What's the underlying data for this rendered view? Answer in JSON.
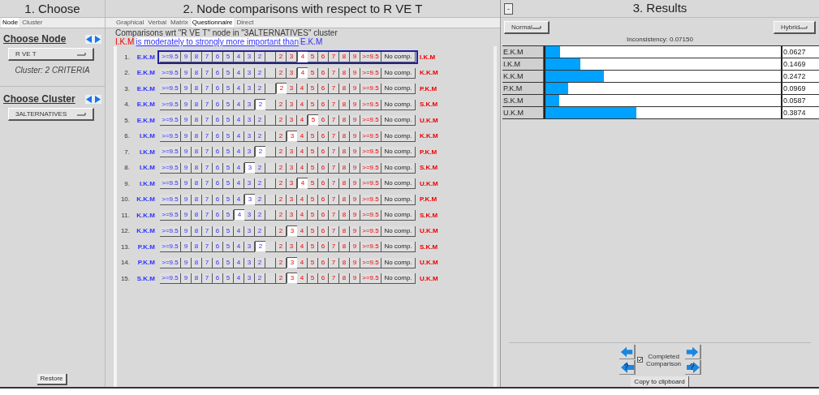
{
  "choose": {
    "title": "1. Choose",
    "tabs": [
      {
        "label": "Node",
        "selected": true
      },
      {
        "label": "Cluster",
        "selected": false
      }
    ],
    "node_heading": "Choose Node",
    "node_dropdown": "R VE T",
    "cluster_info": "Cluster: 2 CRITERIA",
    "cluster_heading": "Choose Cluster",
    "cluster_dropdown": "3ALTERNATIVES",
    "restore_button": "Restore"
  },
  "comparisons": {
    "title": "2. Node comparisons with respect to R VE T",
    "tabs": [
      {
        "label": "Graphical",
        "selected": false
      },
      {
        "label": "Verbal",
        "selected": false
      },
      {
        "label": "Matrix",
        "selected": false
      },
      {
        "label": "Questionnaire",
        "selected": true
      },
      {
        "label": "Direct",
        "selected": false
      }
    ],
    "heading": "Comparisons wrt \"R VE T\" node in \"3ALTERNATIVES\" cluster",
    "statement": {
      "subject": "I.K.M",
      "phrase": "is moderately to strongly more important than",
      "object": "E.K.M"
    },
    "rows": [
      {
        "number": "1.",
        "left": "E.K.M",
        "focused": true,
        "cells": [
          {
            "label": ">=9.5",
            "selected": false
          },
          {
            "label": "9",
            "selected": false
          },
          {
            "label": "8",
            "selected": false
          },
          {
            "label": "7",
            "selected": false
          },
          {
            "label": "6",
            "selected": false
          },
          {
            "label": "5",
            "selected": false
          },
          {
            "label": "4",
            "selected": false
          },
          {
            "label": "3",
            "selected": false
          },
          {
            "label": "2",
            "selected": false
          },
          {
            "selected": false
          },
          {
            "label": "2",
            "selected": false
          },
          {
            "label": "3",
            "selected": false
          },
          {
            "label": "4",
            "selected": true
          },
          {
            "label": "5",
            "selected": false
          },
          {
            "label": "6",
            "selected": false
          },
          {
            "label": "7",
            "selected": false
          },
          {
            "label": "8",
            "selected": false
          },
          {
            "label": "9",
            "selected": false
          },
          {
            "label": ">=9.5",
            "selected": false
          }
        ],
        "no_comp": "No comp.",
        "right": "I.K.M"
      },
      {
        "number": "2.",
        "left": "E.K.M",
        "focused": false,
        "cells": [
          {
            "label": ">=9.5",
            "selected": false
          },
          {
            "label": "9",
            "selected": false
          },
          {
            "label": "8",
            "selected": false
          },
          {
            "label": "7",
            "selected": false
          },
          {
            "label": "6",
            "selected": false
          },
          {
            "label": "5",
            "selected": false
          },
          {
            "label": "4",
            "selected": false
          },
          {
            "label": "3",
            "selected": false
          },
          {
            "label": "2",
            "selected": false
          },
          {
            "selected": false
          },
          {
            "label": "2",
            "selected": false
          },
          {
            "label": "3",
            "selected": false
          },
          {
            "label": "4",
            "selected": true
          },
          {
            "label": "5",
            "selected": false
          },
          {
            "label": "6",
            "selected": false
          },
          {
            "label": "7",
            "selected": false
          },
          {
            "label": "8",
            "selected": false
          },
          {
            "label": "9",
            "selected": false
          },
          {
            "label": ">=9.5",
            "selected": false
          }
        ],
        "no_comp": "No comp.",
        "right": "K.K.M"
      },
      {
        "number": "3.",
        "left": "E.K.M",
        "focused": false,
        "cells": [
          {
            "label": ">=9.5",
            "selected": false
          },
          {
            "label": "9",
            "selected": false
          },
          {
            "label": "8",
            "selected": false
          },
          {
            "label": "7",
            "selected": false
          },
          {
            "label": "6",
            "selected": false
          },
          {
            "label": "5",
            "selected": false
          },
          {
            "label": "4",
            "selected": false
          },
          {
            "label": "3",
            "selected": false
          },
          {
            "label": "2",
            "selected": false
          },
          {
            "selected": false
          },
          {
            "label": "2",
            "selected": true
          },
          {
            "label": "3",
            "selected": false
          },
          {
            "label": "4",
            "selected": false
          },
          {
            "label": "5",
            "selected": false
          },
          {
            "label": "6",
            "selected": false
          },
          {
            "label": "7",
            "selected": false
          },
          {
            "label": "8",
            "selected": false
          },
          {
            "label": "9",
            "selected": false
          },
          {
            "label": ">=9.5",
            "selected": false
          }
        ],
        "no_comp": "No comp.",
        "right": "P.K.M"
      },
      {
        "number": "4.",
        "left": "E.K.M",
        "focused": false,
        "cells": [
          {
            "label": ">=9.5",
            "selected": false
          },
          {
            "label": "9",
            "selected": false
          },
          {
            "label": "8",
            "selected": false
          },
          {
            "label": "7",
            "selected": false
          },
          {
            "label": "6",
            "selected": false
          },
          {
            "label": "5",
            "selected": false
          },
          {
            "label": "4",
            "selected": false
          },
          {
            "label": "3",
            "selected": false
          },
          {
            "label": "2",
            "selected": true
          },
          {
            "selected": false
          },
          {
            "label": "2",
            "selected": false
          },
          {
            "label": "3",
            "selected": false
          },
          {
            "label": "4",
            "selected": false
          },
          {
            "label": "5",
            "selected": false
          },
          {
            "label": "6",
            "selected": false
          },
          {
            "label": "7",
            "selected": false
          },
          {
            "label": "8",
            "selected": false
          },
          {
            "label": "9",
            "selected": false
          },
          {
            "label": ">=9.5",
            "selected": false
          }
        ],
        "no_comp": "No comp.",
        "right": "S.K.M"
      },
      {
        "number": "5.",
        "left": "E.K.M",
        "focused": false,
        "cells": [
          {
            "label": ">=9.5",
            "selected": false
          },
          {
            "label": "9",
            "selected": false
          },
          {
            "label": "8",
            "selected": false
          },
          {
            "label": "7",
            "selected": false
          },
          {
            "label": "6",
            "selected": false
          },
          {
            "label": "5",
            "selected": false
          },
          {
            "label": "4",
            "selected": false
          },
          {
            "label": "3",
            "selected": false
          },
          {
            "label": "2",
            "selected": false
          },
          {
            "selected": false
          },
          {
            "label": "2",
            "selected": false
          },
          {
            "label": "3",
            "selected": false
          },
          {
            "label": "4",
            "selected": false
          },
          {
            "label": "5",
            "selected": true
          },
          {
            "label": "6",
            "selected": false
          },
          {
            "label": "7",
            "selected": false
          },
          {
            "label": "8",
            "selected": false
          },
          {
            "label": "9",
            "selected": false
          },
          {
            "label": ">=9.5",
            "selected": false
          }
        ],
        "no_comp": "No comp.",
        "right": "U.K.M"
      },
      {
        "number": "6.",
        "left": "I.K.M",
        "focused": false,
        "cells": [
          {
            "label": ">=9.5",
            "selected": false
          },
          {
            "label": "9",
            "selected": false
          },
          {
            "label": "8",
            "selected": false
          },
          {
            "label": "7",
            "selected": false
          },
          {
            "label": "6",
            "selected": false
          },
          {
            "label": "5",
            "selected": false
          },
          {
            "label": "4",
            "selected": false
          },
          {
            "label": "3",
            "selected": false
          },
          {
            "label": "2",
            "selected": false
          },
          {
            "selected": false
          },
          {
            "label": "2",
            "selected": false
          },
          {
            "label": "3",
            "selected": true
          },
          {
            "label": "4",
            "selected": false
          },
          {
            "label": "5",
            "selected": false
          },
          {
            "label": "6",
            "selected": false
          },
          {
            "label": "7",
            "selected": false
          },
          {
            "label": "8",
            "selected": false
          },
          {
            "label": "9",
            "selected": false
          },
          {
            "label": ">=9.5",
            "selected": false
          }
        ],
        "no_comp": "No comp.",
        "right": "K.K.M"
      },
      {
        "number": "7.",
        "left": "I.K.M",
        "focused": false,
        "cells": [
          {
            "label": ">=9.5",
            "selected": false
          },
          {
            "label": "9",
            "selected": false
          },
          {
            "label": "8",
            "selected": false
          },
          {
            "label": "7",
            "selected": false
          },
          {
            "label": "6",
            "selected": false
          },
          {
            "label": "5",
            "selected": false
          },
          {
            "label": "4",
            "selected": false
          },
          {
            "label": "3",
            "selected": false
          },
          {
            "label": "2",
            "selected": true
          },
          {
            "selected": false
          },
          {
            "label": "2",
            "selected": false
          },
          {
            "label": "3",
            "selected": false
          },
          {
            "label": "4",
            "selected": false
          },
          {
            "label": "5",
            "selected": false
          },
          {
            "label": "6",
            "selected": false
          },
          {
            "label": "7",
            "selected": false
          },
          {
            "label": "8",
            "selected": false
          },
          {
            "label": "9",
            "selected": false
          },
          {
            "label": ">=9.5",
            "selected": false
          }
        ],
        "no_comp": "No comp.",
        "right": "P.K.M"
      },
      {
        "number": "8.",
        "left": "I.K.M",
        "focused": false,
        "cells": [
          {
            "label": ">=9.5",
            "selected": false
          },
          {
            "label": "9",
            "selected": false
          },
          {
            "label": "8",
            "selected": false
          },
          {
            "label": "7",
            "selected": false
          },
          {
            "label": "6",
            "selected": false
          },
          {
            "label": "5",
            "selected": false
          },
          {
            "label": "4",
            "selected": false
          },
          {
            "label": "3",
            "selected": true
          },
          {
            "label": "2",
            "selected": false
          },
          {
            "selected": false
          },
          {
            "label": "2",
            "selected": false
          },
          {
            "label": "3",
            "selected": false
          },
          {
            "label": "4",
            "selected": false
          },
          {
            "label": "5",
            "selected": false
          },
          {
            "label": "6",
            "selected": false
          },
          {
            "label": "7",
            "selected": false
          },
          {
            "label": "8",
            "selected": false
          },
          {
            "label": "9",
            "selected": false
          },
          {
            "label": ">=9.5",
            "selected": false
          }
        ],
        "no_comp": "No comp.",
        "right": "S.K.M"
      },
      {
        "number": "9.",
        "left": "I.K.M",
        "focused": false,
        "cells": [
          {
            "label": ">=9.5",
            "selected": false
          },
          {
            "label": "9",
            "selected": false
          },
          {
            "label": "8",
            "selected": false
          },
          {
            "label": "7",
            "selected": false
          },
          {
            "label": "6",
            "selected": false
          },
          {
            "label": "5",
            "selected": false
          },
          {
            "label": "4",
            "selected": false
          },
          {
            "label": "3",
            "selected": false
          },
          {
            "label": "2",
            "selected": false
          },
          {
            "selected": false
          },
          {
            "label": "2",
            "selected": false
          },
          {
            "label": "3",
            "selected": false
          },
          {
            "label": "4",
            "selected": true
          },
          {
            "label": "5",
            "selected": false
          },
          {
            "label": "6",
            "selected": false
          },
          {
            "label": "7",
            "selected": false
          },
          {
            "label": "8",
            "selected": false
          },
          {
            "label": "9",
            "selected": false
          },
          {
            "label": ">=9.5",
            "selected": false
          }
        ],
        "no_comp": "No comp.",
        "right": "U.K.M"
      },
      {
        "number": "10.",
        "left": "K.K.M",
        "focused": false,
        "cells": [
          {
            "label": ">=9.5",
            "selected": false
          },
          {
            "label": "9",
            "selected": false
          },
          {
            "label": "8",
            "selected": false
          },
          {
            "label": "7",
            "selected": false
          },
          {
            "label": "6",
            "selected": false
          },
          {
            "label": "5",
            "selected": false
          },
          {
            "label": "4",
            "selected": false
          },
          {
            "label": "3",
            "selected": true
          },
          {
            "label": "2",
            "selected": false
          },
          {
            "selected": false
          },
          {
            "label": "2",
            "selected": false
          },
          {
            "label": "3",
            "selected": false
          },
          {
            "label": "4",
            "selected": false
          },
          {
            "label": "5",
            "selected": false
          },
          {
            "label": "6",
            "selected": false
          },
          {
            "label": "7",
            "selected": false
          },
          {
            "label": "8",
            "selected": false
          },
          {
            "label": "9",
            "selected": false
          },
          {
            "label": ">=9.5",
            "selected": false
          }
        ],
        "no_comp": "No comp.",
        "right": "P.K.M"
      },
      {
        "number": "11.",
        "left": "K.K.M",
        "focused": false,
        "cells": [
          {
            "label": ">=9.5",
            "selected": false
          },
          {
            "label": "9",
            "selected": false
          },
          {
            "label": "8",
            "selected": false
          },
          {
            "label": "7",
            "selected": false
          },
          {
            "label": "6",
            "selected": false
          },
          {
            "label": "5",
            "selected": false
          },
          {
            "label": "4",
            "selected": true
          },
          {
            "label": "3",
            "selected": false
          },
          {
            "label": "2",
            "selected": false
          },
          {
            "selected": false
          },
          {
            "label": "2",
            "selected": false
          },
          {
            "label": "3",
            "selected": false
          },
          {
            "label": "4",
            "selected": false
          },
          {
            "label": "5",
            "selected": false
          },
          {
            "label": "6",
            "selected": false
          },
          {
            "label": "7",
            "selected": false
          },
          {
            "label": "8",
            "selected": false
          },
          {
            "label": "9",
            "selected": false
          },
          {
            "label": ">=9.5",
            "selected": false
          }
        ],
        "no_comp": "No comp.",
        "right": "S.K.M"
      },
      {
        "number": "12.",
        "left": "K.K.M",
        "focused": false,
        "cells": [
          {
            "label": ">=9.5",
            "selected": false
          },
          {
            "label": "9",
            "selected": false
          },
          {
            "label": "8",
            "selected": false
          },
          {
            "label": "7",
            "selected": false
          },
          {
            "label": "6",
            "selected": false
          },
          {
            "label": "5",
            "selected": false
          },
          {
            "label": "4",
            "selected": false
          },
          {
            "label": "3",
            "selected": false
          },
          {
            "label": "2",
            "selected": false
          },
          {
            "selected": false
          },
          {
            "label": "2",
            "selected": false
          },
          {
            "label": "3",
            "selected": true
          },
          {
            "label": "4",
            "selected": false
          },
          {
            "label": "5",
            "selected": false
          },
          {
            "label": "6",
            "selected": false
          },
          {
            "label": "7",
            "selected": false
          },
          {
            "label": "8",
            "selected": false
          },
          {
            "label": "9",
            "selected": false
          },
          {
            "label": ">=9.5",
            "selected": false
          }
        ],
        "no_comp": "No comp.",
        "right": "U.K.M"
      },
      {
        "number": "13.",
        "left": "P.K.M",
        "focused": false,
        "cells": [
          {
            "label": ">=9.5",
            "selected": false
          },
          {
            "label": "9",
            "selected": false
          },
          {
            "label": "8",
            "selected": false
          },
          {
            "label": "7",
            "selected": false
          },
          {
            "label": "6",
            "selected": false
          },
          {
            "label": "5",
            "selected": false
          },
          {
            "label": "4",
            "selected": false
          },
          {
            "label": "3",
            "selected": false
          },
          {
            "label": "2",
            "selected": true
          },
          {
            "selected": false
          },
          {
            "label": "2",
            "selected": false
          },
          {
            "label": "3",
            "selected": false
          },
          {
            "label": "4",
            "selected": false
          },
          {
            "label": "5",
            "selected": false
          },
          {
            "label": "6",
            "selected": false
          },
          {
            "label": "7",
            "selected": false
          },
          {
            "label": "8",
            "selected": false
          },
          {
            "label": "9",
            "selected": false
          },
          {
            "label": ">=9.5",
            "selected": false
          }
        ],
        "no_comp": "No comp.",
        "right": "S.K.M"
      },
      {
        "number": "14.",
        "left": "P.K.M",
        "focused": false,
        "cells": [
          {
            "label": ">=9.5",
            "selected": false
          },
          {
            "label": "9",
            "selected": false
          },
          {
            "label": "8",
            "selected": false
          },
          {
            "label": "7",
            "selected": false
          },
          {
            "label": "6",
            "selected": false
          },
          {
            "label": "5",
            "selected": false
          },
          {
            "label": "4",
            "selected": false
          },
          {
            "label": "3",
            "selected": false
          },
          {
            "label": "2",
            "selected": false
          },
          {
            "selected": false
          },
          {
            "label": "2",
            "selected": false
          },
          {
            "label": "3",
            "selected": true
          },
          {
            "label": "4",
            "selected": false
          },
          {
            "label": "5",
            "selected": false
          },
          {
            "label": "6",
            "selected": false
          },
          {
            "label": "7",
            "selected": false
          },
          {
            "label": "8",
            "selected": false
          },
          {
            "label": "9",
            "selected": false
          },
          {
            "label": ">=9.5",
            "selected": false
          }
        ],
        "no_comp": "No comp.",
        "right": "U.K.M"
      },
      {
        "number": "15.",
        "left": "S.K.M",
        "focused": false,
        "cells": [
          {
            "label": ">=9.5",
            "selected": false
          },
          {
            "label": "9",
            "selected": false
          },
          {
            "label": "8",
            "selected": false
          },
          {
            "label": "7",
            "selected": false
          },
          {
            "label": "6",
            "selected": false
          },
          {
            "label": "5",
            "selected": false
          },
          {
            "label": "4",
            "selected": false
          },
          {
            "label": "3",
            "selected": false
          },
          {
            "label": "2",
            "selected": false
          },
          {
            "selected": false
          },
          {
            "label": "2",
            "selected": false
          },
          {
            "label": "3",
            "selected": true
          },
          {
            "label": "4",
            "selected": false
          },
          {
            "label": "5",
            "selected": false
          },
          {
            "label": "6",
            "selected": false
          },
          {
            "label": "7",
            "selected": false
          },
          {
            "label": "8",
            "selected": false
          },
          {
            "label": "9",
            "selected": false
          },
          {
            "label": ">=9.5",
            "selected": false
          }
        ],
        "no_comp": "No comp.",
        "right": "U.K.M"
      }
    ]
  },
  "results": {
    "collapse_button": "-",
    "title": "3. Results",
    "mode_dropdown": "Normal",
    "method_dropdown": "Hybrid",
    "inconsistency": "Inconsistency: 0.07150",
    "priorities": [
      {
        "name": "E.K.M",
        "level": 0.06277,
        "value": "0.0627"
      },
      {
        "name": "I.K.M",
        "level": 0.14694,
        "value": "0.1469"
      },
      {
        "name": "K.K.M",
        "level": 0.24722,
        "value": "0.2472"
      },
      {
        "name": "P.K.M",
        "level": 0.09693,
        "value": "0.0969"
      },
      {
        "name": "S.K.M",
        "level": 0.05871,
        "value": "0.0587"
      },
      {
        "name": "U.K.M",
        "level": 0.38742,
        "value": "0.3874"
      }
    ],
    "help_marks": [
      "?",
      "?"
    ],
    "completed": {
      "label": "Completed Comparison",
      "checked": true
    },
    "copy_button": "Copy to clipboard"
  }
}
